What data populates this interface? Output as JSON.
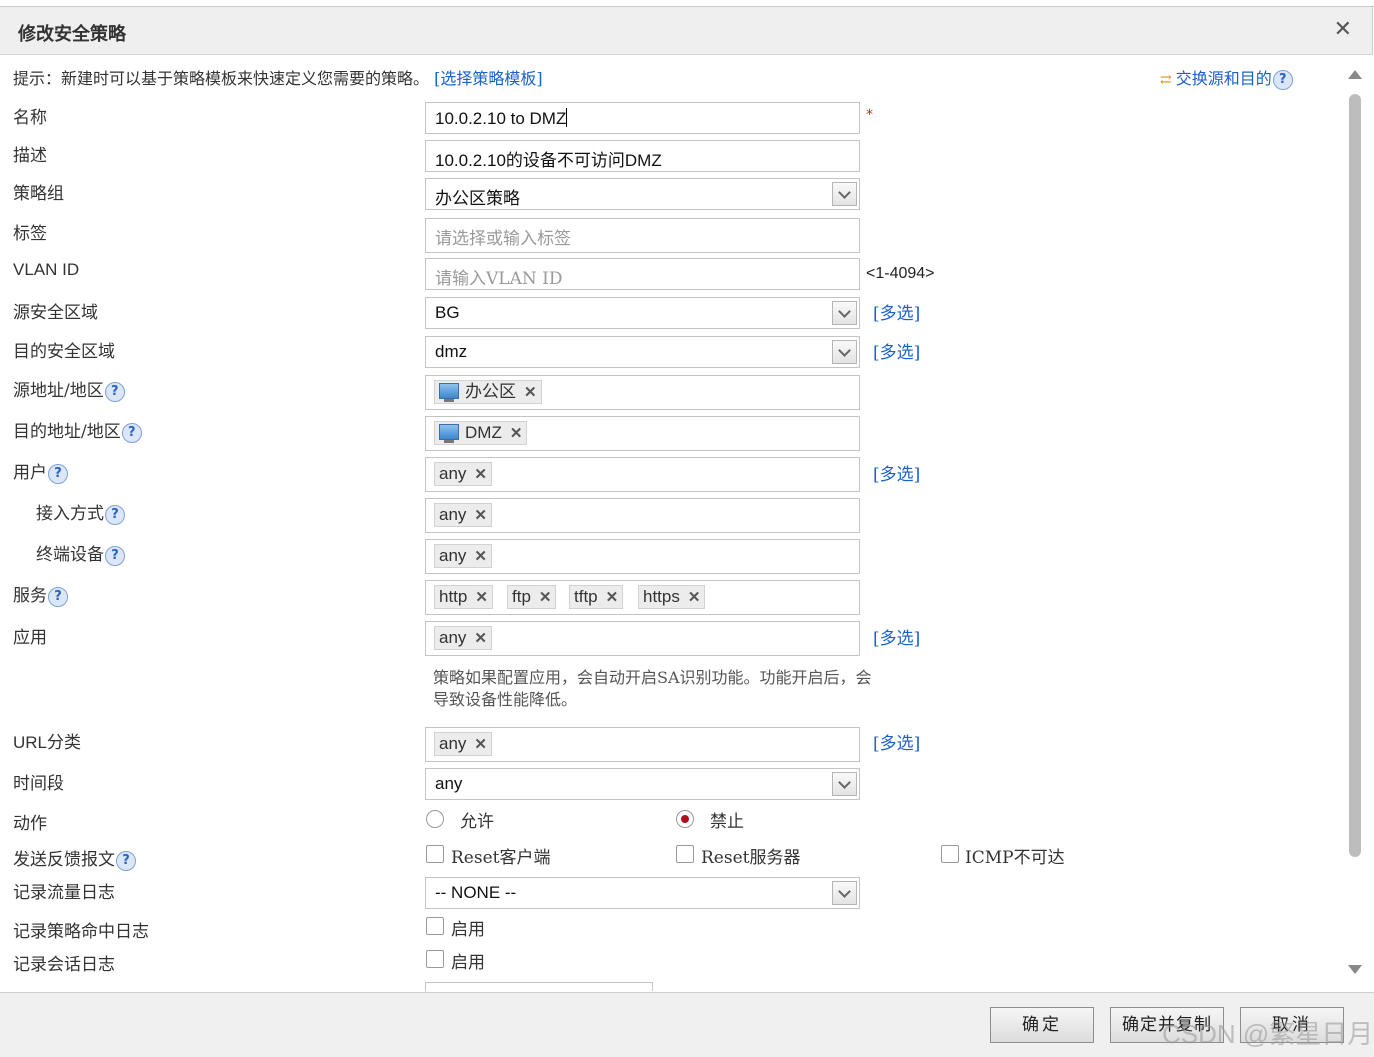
{
  "dialog": {
    "title": "修改安全策略",
    "close_icon": "close-icon"
  },
  "hint": {
    "text": "提示：新建时可以基于策略模板来快速定义您需要的策略。",
    "link": "[选择策略模板]"
  },
  "swap": {
    "label": "交换源和目的"
  },
  "form": {
    "name": {
      "label": "名称",
      "value": "10.0.2.10 to DMZ",
      "required_mark": "*"
    },
    "desc": {
      "label": "描述",
      "value": "10.0.2.10的设备不可访问DMZ"
    },
    "group": {
      "label": "策略组",
      "value": "办公区策略"
    },
    "tags": {
      "label": "标签",
      "placeholder": "请选择或输入标签"
    },
    "vlan": {
      "label": "VLAN ID",
      "placeholder": "请输入VLAN ID",
      "range": "<1-4094>"
    },
    "src_zone": {
      "label": "源安全区域",
      "value": "BG",
      "multi": "[多选]"
    },
    "dst_zone": {
      "label": "目的安全区域",
      "value": "dmz",
      "multi": "[多选]"
    },
    "src_addr": {
      "label": "源地址/地区",
      "tags": [
        "办公区"
      ]
    },
    "dst_addr": {
      "label": "目的地址/地区",
      "tags": [
        "DMZ"
      ]
    },
    "user": {
      "label": "用户",
      "tags": [
        "any"
      ],
      "multi": "[多选]"
    },
    "access": {
      "label": "接入方式",
      "tags": [
        "any"
      ]
    },
    "terminal": {
      "label": "终端设备",
      "tags": [
        "any"
      ]
    },
    "service": {
      "label": "服务",
      "tags": [
        "http",
        "ftp",
        "tftp",
        "https"
      ]
    },
    "app": {
      "label": "应用",
      "tags": [
        "any"
      ],
      "multi": "[多选]",
      "note": "策略如果配置应用，会自动开启SA识别功能。功能开启后，会导致设备性能降低。"
    },
    "url": {
      "label": "URL分类",
      "tags": [
        "any"
      ],
      "multi": "[多选]"
    },
    "time": {
      "label": "时间段",
      "value": "any"
    },
    "action": {
      "label": "动作",
      "options": [
        "允许",
        "禁止"
      ],
      "selected": "禁止"
    },
    "feedback": {
      "label": "发送反馈报文",
      "options": [
        "Reset客户端",
        "Reset服务器",
        "ICMP不可达"
      ]
    },
    "traffic_log": {
      "label": "记录流量日志",
      "value": "-- NONE --"
    },
    "hit_log": {
      "label": "记录策略命中日志",
      "option": "启用"
    },
    "session_log": {
      "label": "记录会话日志",
      "option": "启用"
    }
  },
  "footer": {
    "ok": "确定",
    "ok_copy": "确定并复制",
    "cancel": "取消"
  },
  "watermark": "CSDN @繁星日月",
  "colors": {
    "link": "#1a61c9",
    "required": "#d22222",
    "radio_selected": "#b0121b"
  }
}
